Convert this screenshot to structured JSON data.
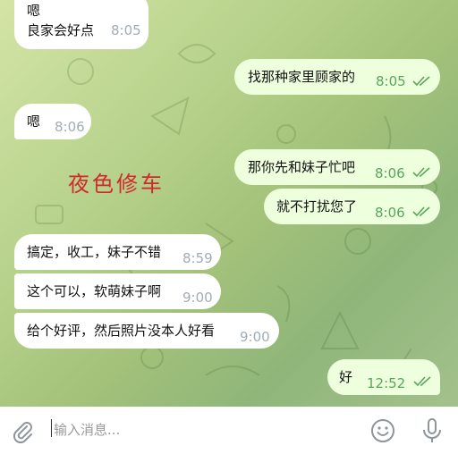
{
  "messages": [
    {
      "side": "in",
      "lines": [
        "嗯",
        "良家会好点"
      ],
      "time": "8:05"
    },
    {
      "side": "out",
      "lines": [
        "找那种家里顾家的"
      ],
      "time": "8:05",
      "read": true
    },
    {
      "side": "in",
      "lines": [
        "嗯"
      ],
      "time": "8:06"
    },
    {
      "side": "out",
      "lines": [
        "那你先和妹子忙吧"
      ],
      "time": "8:06",
      "read": true
    },
    {
      "side": "out",
      "lines": [
        "就不打扰您了"
      ],
      "time": "8:06",
      "read": true
    },
    {
      "side": "in",
      "lines": [
        "搞定，收工，妹子不错"
      ],
      "time": "8:59"
    },
    {
      "side": "in",
      "lines": [
        "这个可以，软萌妹子啊"
      ],
      "time": "9:00"
    },
    {
      "side": "in",
      "lines": [
        "给个好评，然后照片没本人好看"
      ],
      "time": "9:00"
    },
    {
      "side": "out",
      "lines": [
        "好"
      ],
      "time": "12:52",
      "read": true
    }
  ],
  "watermark": "夜色修车",
  "input": {
    "placeholder": "输入消息..."
  },
  "icons": {
    "attach": "paperclip-icon",
    "emoji": "emoji-icon",
    "voice": "microphone-icon",
    "read": "double-check-icon"
  },
  "colors": {
    "outgoing_bubble": "#eeffde",
    "incoming_bubble": "#ffffff",
    "check": "#5aa65d",
    "watermark": "#d2272d"
  }
}
